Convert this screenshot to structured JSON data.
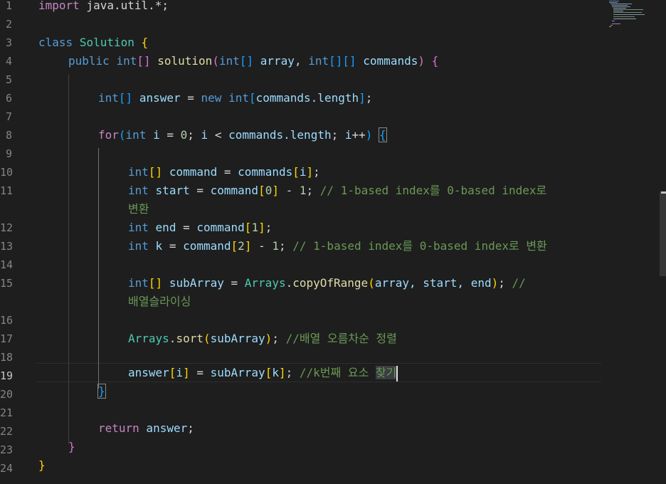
{
  "editor": {
    "language": "java",
    "active_line": "19",
    "line_numbers": [
      "1",
      "2",
      "3",
      "4",
      "5",
      "6",
      "7",
      "8",
      "9",
      "10",
      "11",
      "12",
      "13",
      "14",
      "15",
      "16",
      "17",
      "18",
      "19",
      "20",
      "21",
      "22",
      "23",
      "24"
    ],
    "tokens": {
      "l1_import": "import",
      "l1_pkg": " java.util.*;",
      "l3_class": "class",
      "l3_name": "Solution",
      "l3_brace": "{",
      "l4_public": "public",
      "l4_int": "int",
      "l4_arr": "[]",
      "l4_fn": "solution",
      "l4_open": "(",
      "l4_int2": "int",
      "l4_arr2": "[]",
      "l4_param1": "array",
      "l4_comma": ", ",
      "l4_int3": "int",
      "l4_arr3": "[][]",
      "l4_param2": "commands",
      "l4_close": ")",
      "l4_brace": "{",
      "l6_int": "int",
      "l6_arr": "[]",
      "l6_var": "answer",
      "l6_eq": " = ",
      "l6_new": "new",
      "l6_int2": "int",
      "l6_open": "[",
      "l6_expr": "commands.length",
      "l6_close": "]",
      "l6_semi": ";",
      "l8_for": "for",
      "l8_open": "(",
      "l8_int": "int",
      "l8_i": "i",
      "l8_eq": " = ",
      "l8_zero": "0",
      "l8_semi": "; ",
      "l8_i2": "i",
      "l8_lt": " < ",
      "l8_len": "commands.length",
      "l8_semi2": "; ",
      "l8_inc": "i",
      "l8_pp": "++",
      "l8_close": ")",
      "l8_brace": "{",
      "l10_int": "int",
      "l10_arr": "[]",
      "l10_var": "command",
      "l10_eq": " = ",
      "l10_cmds": "commands",
      "l10_open": "[",
      "l10_i": "i",
      "l10_close": "]",
      "l10_semi": ";",
      "l11_int": "int",
      "l11_var": "start",
      "l11_eq": " = ",
      "l11_cmd": "command",
      "l11_open": "[",
      "l11_zero": "0",
      "l11_close": "]",
      "l11_minus": " - ",
      "l11_one": "1",
      "l11_semi": "; ",
      "l11_cmt": "// 1-based index를 0-based index로",
      "l11_cmt_cont": "변환",
      "l12_int": "int",
      "l12_var": "end",
      "l12_eq": " = ",
      "l12_cmd": "command",
      "l12_open": "[",
      "l12_one": "1",
      "l12_close": "]",
      "l12_semi": ";",
      "l13_int": "int",
      "l13_var": "k",
      "l13_eq": " = ",
      "l13_cmd": "command",
      "l13_open": "[",
      "l13_two": "2",
      "l13_close": "]",
      "l13_minus": " - ",
      "l13_one": "1",
      "l13_semi": "; ",
      "l13_cmt": "// 1-based index를 0-based index로 변환",
      "l15_int": "int",
      "l15_arr": "[]",
      "l15_var": "subArray",
      "l15_eq": " = ",
      "l15_cls": "Arrays",
      "l15_dot": ".",
      "l15_fn": "copyOfRange",
      "l15_open": "(",
      "l15_args": "array, start, end",
      "l15_close": ")",
      "l15_semi": "; ",
      "l15_cmt": "//",
      "l15_cmt_cont": "배열슬라이싱",
      "l17_cls": "Arrays",
      "l17_dot": ".",
      "l17_fn": "sort",
      "l17_open": "(",
      "l17_arg": "subArray",
      "l17_close": ")",
      "l17_semi": "; ",
      "l17_cmt": "//배열 오름차순 정렬",
      "l19_var": "answer",
      "l19_open": "[",
      "l19_i": "i",
      "l19_close": "]",
      "l19_eq": " = ",
      "l19_sub": "subArray",
      "l19_open2": "[",
      "l19_k": "k",
      "l19_close2": "]",
      "l19_semi": "; ",
      "l19_cmt": "//k번째 요소 ",
      "l19_sel": "찾기",
      "l20_brace": "}",
      "l22_return": "return",
      "l22_var": " answer",
      "l22_semi": ";",
      "l23_brace": "}",
      "l24_brace": "}"
    }
  },
  "colors": {
    "background": "#1e1e1e",
    "keyword": "#569cd6",
    "control": "#c586c0",
    "class": "#4ec9b0",
    "function": "#dcdcaa",
    "variable": "#9cdcfe",
    "number": "#b5cea8",
    "comment": "#6a9955",
    "bracket_level1": "#ffd700",
    "bracket_level2": "#da70d6",
    "bracket_level3": "#179fff"
  }
}
